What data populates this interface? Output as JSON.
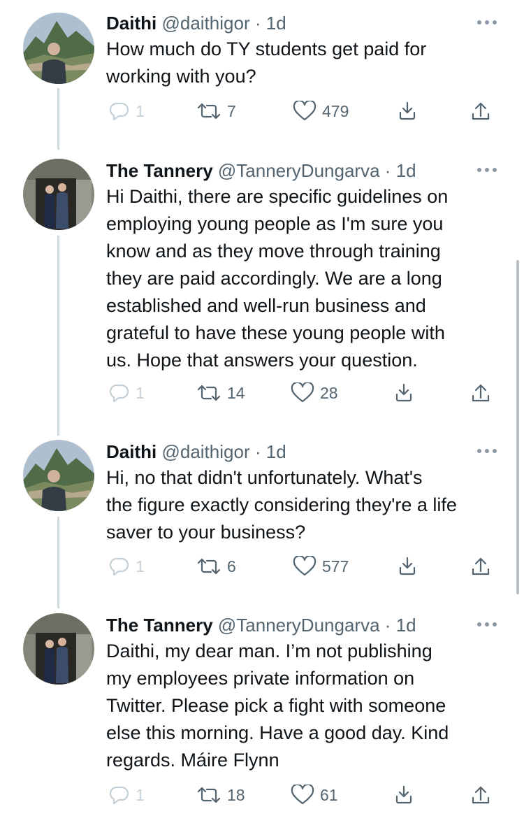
{
  "tweets": [
    {
      "name": "Daithi",
      "handle": "@daithigor",
      "dot": "·",
      "time": "1d",
      "lines": [
        "How much do TY students get paid for",
        "working with you?"
      ],
      "replies": "1",
      "retweets": "7",
      "likes": "479"
    },
    {
      "name": "The Tannery",
      "handle": "@TanneryDungarva",
      "dot": "·",
      "time": "1d",
      "lines": [
        "Hi Daithi, there are specific guidelines on",
        "employing young people as I'm sure you",
        "know and as they move through training",
        "they are paid accordingly. We are a long",
        "established and well-run business and",
        "grateful to have these young people with",
        "us. Hope that answers your question."
      ],
      "replies": "1",
      "retweets": "14",
      "likes": "28"
    },
    {
      "name": "Daithi",
      "handle": "@daithigor",
      "dot": "·",
      "time": "1d",
      "lines": [
        "Hi, no that didn't unfortunately. What's",
        "the figure exactly considering they're a life",
        "saver to your business?"
      ],
      "replies": "1",
      "retweets": "6",
      "likes": "577"
    },
    {
      "name": "The Tannery",
      "handle": "@TanneryDungarva",
      "dot": "·",
      "time": "1d",
      "lines": [
        "Daithi, my dear man. I’m not publishing",
        "my employees private information on",
        "Twitter. Please pick a fight with someone",
        "else this morning. Have a good day. Kind",
        "regards. Máire Flynn"
      ],
      "replies": "1",
      "retweets": "18",
      "likes": "61"
    }
  ],
  "icons": {
    "reply": "speech-bubble",
    "retweet": "retweet-arrows",
    "like": "heart-outline",
    "bookmark": "bookmark-down-arrow",
    "share": "share-up-arrow",
    "more": "ellipsis"
  },
  "colors": {
    "text": "#0f1419",
    "secondary": "#536471",
    "thread_line": "#cfd9de",
    "reply_faded": "#c4cfd6"
  }
}
